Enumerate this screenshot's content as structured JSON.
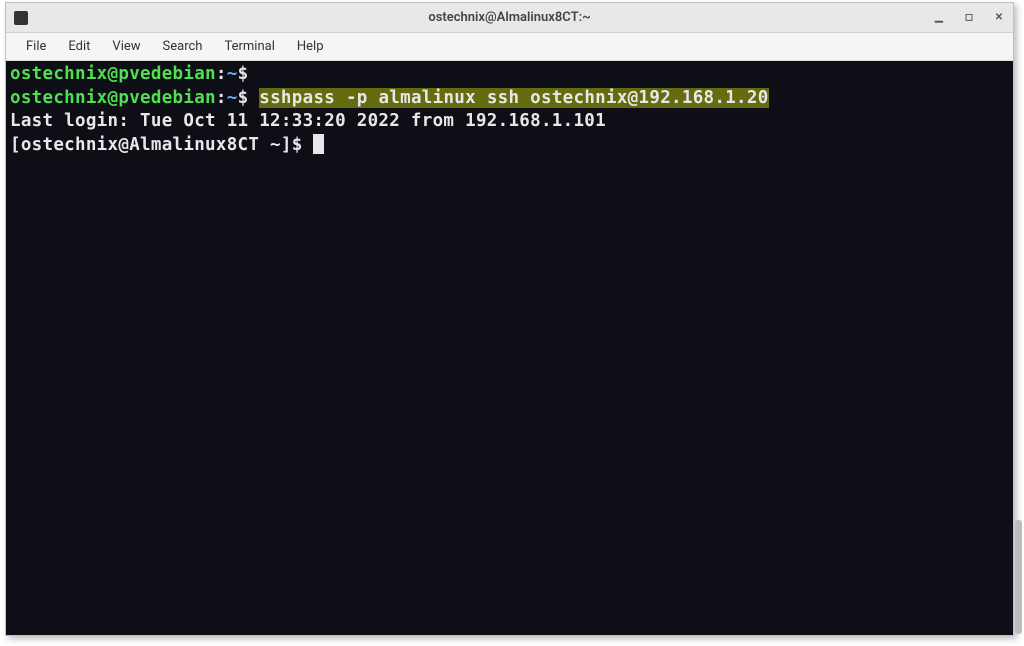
{
  "window": {
    "title": "ostechnix@Almalinux8CT:~"
  },
  "menu": {
    "items": [
      "File",
      "Edit",
      "View",
      "Search",
      "Terminal",
      "Help"
    ]
  },
  "terminal": {
    "lines": [
      {
        "prompt": {
          "userhost": "ostechnix@pvedebian",
          "sep": ":",
          "path": "~",
          "sigil": "$"
        },
        "command": "",
        "highlight": false
      },
      {
        "prompt": {
          "userhost": "ostechnix@pvedebian",
          "sep": ":",
          "path": "~",
          "sigil": "$"
        },
        "command": "sshpass -p almalinux ssh ostechnix@192.168.1.20",
        "highlight": true
      }
    ],
    "output": "Last login: Tue Oct 11 12:33:20 2022 from 192.168.1.101",
    "remote_prompt": "[ostechnix@Almalinux8CT ~]$ "
  }
}
